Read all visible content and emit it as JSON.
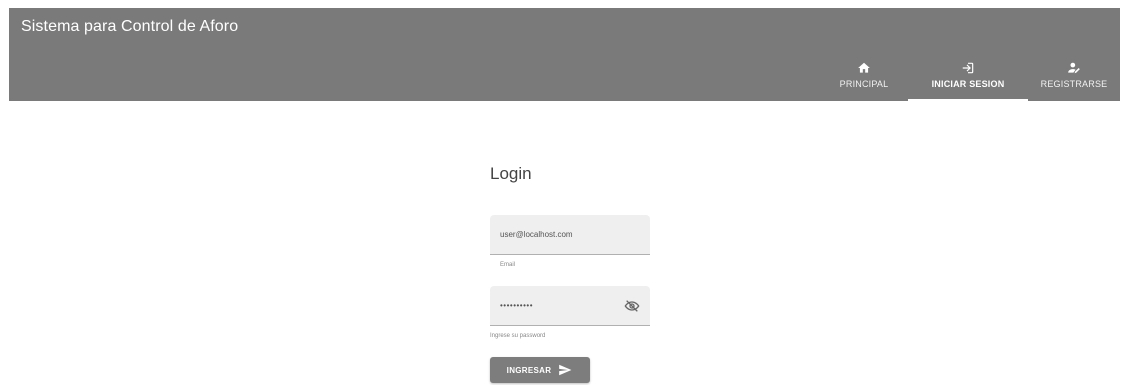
{
  "app": {
    "title": "Sistema para Control de Aforo"
  },
  "nav": {
    "items": [
      {
        "label": "PRINCIPAL",
        "icon": "home-icon",
        "active": false
      },
      {
        "label": "INICIAR SESION",
        "icon": "login-icon",
        "active": true
      },
      {
        "label": "REGISTRARSE",
        "icon": "person-add-icon",
        "active": false
      }
    ]
  },
  "login": {
    "title": "Login",
    "email": {
      "value": "user@localhost.com",
      "hint": "Email"
    },
    "password": {
      "value": "••••••••••",
      "hint": "Ingrese su password",
      "toggle_icon": "eye-off-icon"
    },
    "submit_label": "INGRESAR",
    "submit_icon": "send-icon"
  },
  "colors": {
    "appbar": "#7a7a7a",
    "button": "#7d7d7d",
    "field_bg": "#efefef"
  }
}
